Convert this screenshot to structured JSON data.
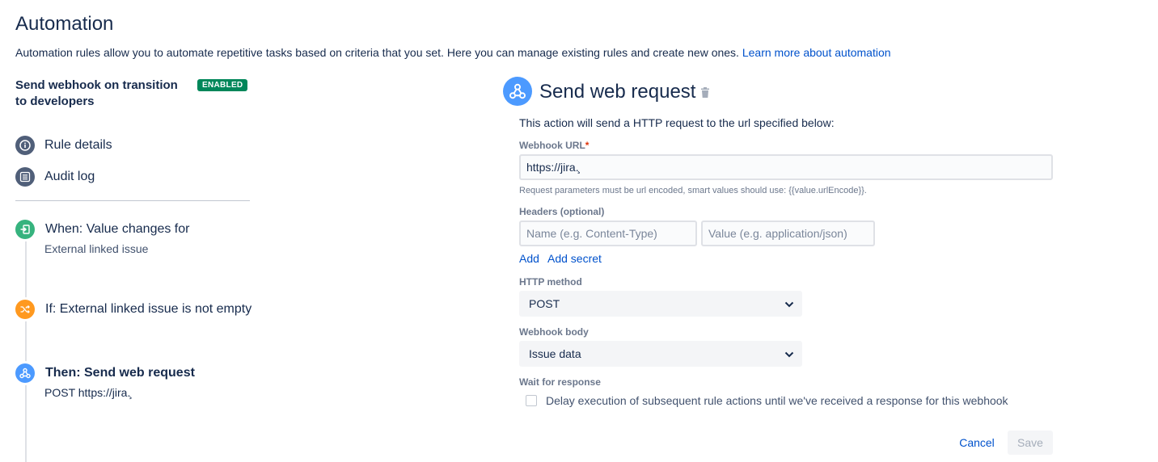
{
  "header": {
    "title": "Automation",
    "description": "Automation rules allow you to automate repetitive tasks based on criteria that you set. Here you can manage existing rules and create new ones.",
    "learn_more_link": "Learn more about automation"
  },
  "rule": {
    "name": "Send webhook on transition to developers",
    "status_badge": "ENABLED"
  },
  "nav": {
    "items": [
      {
        "label": "Rule details",
        "icon": "info-icon"
      },
      {
        "label": "Audit log",
        "icon": "list-icon"
      }
    ]
  },
  "steps": [
    {
      "title": "When: Value changes for",
      "subtitle": "External linked issue",
      "icon": "trigger-icon",
      "color": "#36b37e"
    },
    {
      "title": "If: External linked issue is not empty",
      "icon": "shuffle-icon",
      "color": "#ff991f"
    },
    {
      "title": "Then: Send web request",
      "subtitle": "POST https://jira.̧",
      "icon": "webhook-icon",
      "color": "#4c9aff"
    }
  ],
  "action": {
    "title": "Send web request",
    "intro": "This action will send a HTTP request to the url specified below:",
    "webhook_url_label": "Webhook URL",
    "required_marker": "*",
    "webhook_url_value": "https://jira.̧",
    "helper_text": "Request parameters must be url encoded, smart values should use: {{value.urlEncode}}.",
    "headers_label": "Headers (optional)",
    "header_name_placeholder": "Name (e.g. Content-Type)",
    "header_value_placeholder": "Value (e.g. application/json)",
    "add_label": "Add",
    "add_secret_label": "Add secret",
    "http_method_label": "HTTP method",
    "http_method_value": "POST",
    "webhook_body_label": "Webhook body",
    "webhook_body_value": "Issue data",
    "wait_label": "Wait for response",
    "wait_checkbox_label": "Delay execution of subsequent rule actions until we've received a response for this webhook",
    "wait_checked": false,
    "cancel_label": "Cancel",
    "save_label": "Save"
  },
  "colors": {
    "enabled_badge": "#00875a",
    "link": "#0052cc",
    "nav_icon": "#505f79",
    "required": "#de350b"
  }
}
